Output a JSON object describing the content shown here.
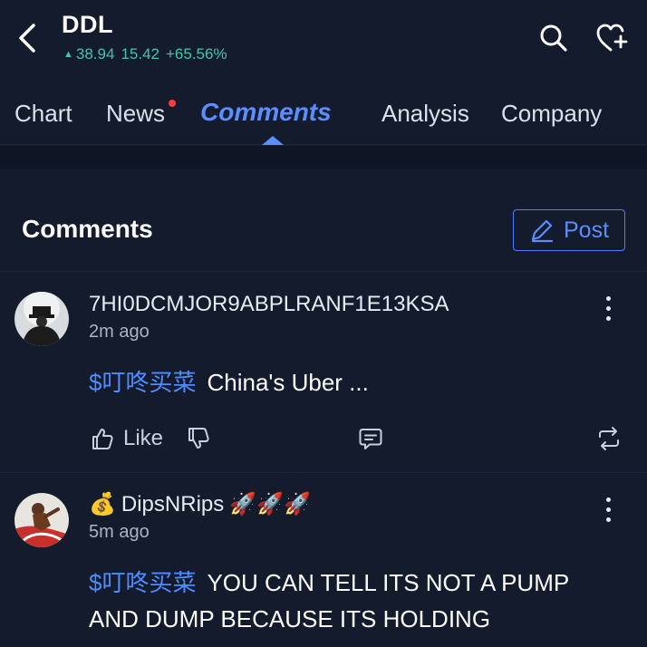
{
  "header": {
    "ticker": "DDL",
    "price_arrow": "▲",
    "price": "38.94",
    "change": "15.42",
    "change_pct": "+65.56%"
  },
  "tabs": [
    {
      "label": "Chart"
    },
    {
      "label": "News",
      "has_badge": true
    },
    {
      "label": "Comments",
      "active": true
    },
    {
      "label": "Analysis"
    },
    {
      "label": "Company"
    }
  ],
  "section": {
    "title": "Comments",
    "post_label": "Post"
  },
  "comments": [
    {
      "author": "7HI0DCMJOR9ABPLRANF1E13KSA",
      "time": "2m ago",
      "cashtag": "$叮咚买菜",
      "text": "China's Uber ...",
      "like_label": "Like"
    },
    {
      "author_prefix_emoji": "💰",
      "author": "DipsNRips",
      "author_suffix_emoji": "🚀🚀🚀",
      "time": "5m ago",
      "cashtag": "$叮咚买菜",
      "text_line1": "YOU CAN TELL ITS NOT A PUMP",
      "text_line2": "AND DUMP BECAUSE ITS HOLDING"
    }
  ],
  "colors": {
    "background": "#141b2d",
    "accent": "#5b8dff",
    "positive": "#3fc7a6",
    "badge": "#ff3b3b"
  }
}
